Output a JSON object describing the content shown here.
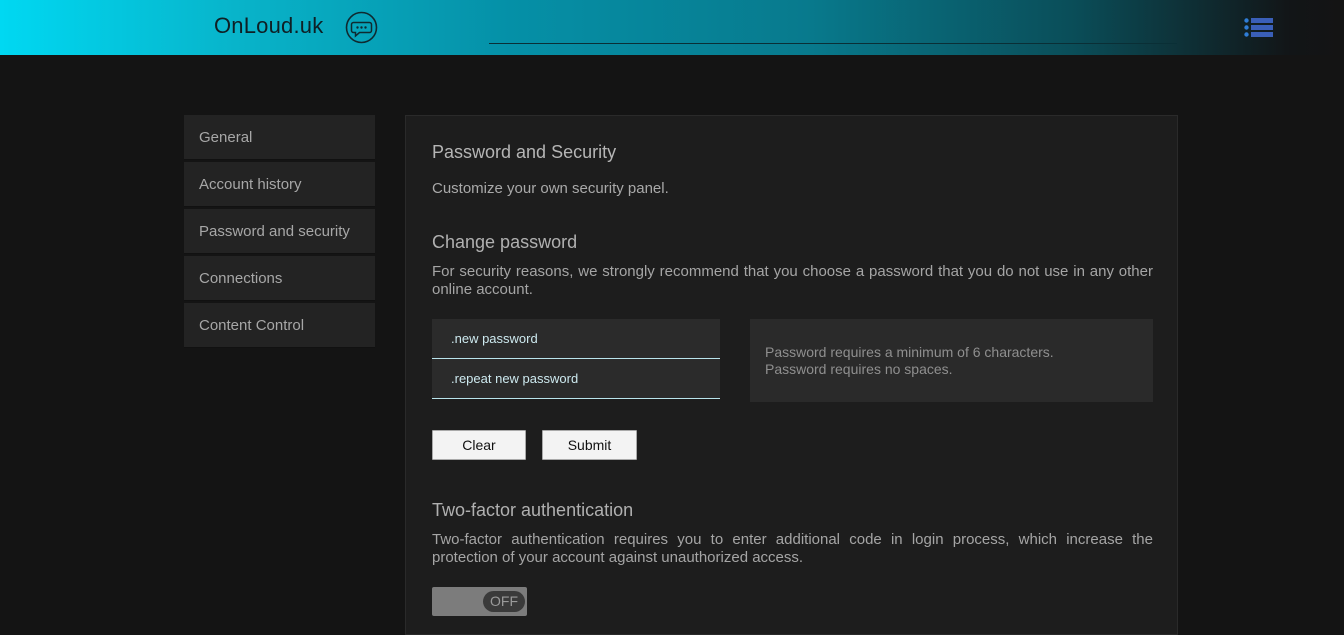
{
  "header": {
    "brand": "OnLoud.uk",
    "chat_icon": "chat-bubble-icon",
    "menu_icon": "list-menu-icon"
  },
  "sidebar": {
    "items": [
      {
        "label": "General"
      },
      {
        "label": "Account history"
      },
      {
        "label": "Password and security"
      },
      {
        "label": "Connections"
      },
      {
        "label": "Content Control"
      }
    ]
  },
  "panel": {
    "title": "Password and Security",
    "subtitle": "Customize your own security panel.",
    "change_password": {
      "title": "Change password",
      "description": "For security reasons, we strongly recommend that you choose a password that you do not use in any other online account.",
      "new_password_placeholder": ".new password",
      "repeat_password_placeholder": ".repeat new password",
      "requirements": [
        "Password requires a minimum of 6 characters.",
        "Password requires no spaces."
      ],
      "clear_label": "Clear",
      "submit_label": "Submit"
    },
    "two_factor": {
      "title": "Two-factor authentication",
      "description": "Two-factor authentication requires you to enter additional code in login process, which increase the protection of your account against unauthorized access.",
      "toggle_state": "OFF"
    }
  },
  "colors": {
    "accent": "#00d8f2",
    "background": "#141414",
    "panel": "#1d1d1d"
  }
}
